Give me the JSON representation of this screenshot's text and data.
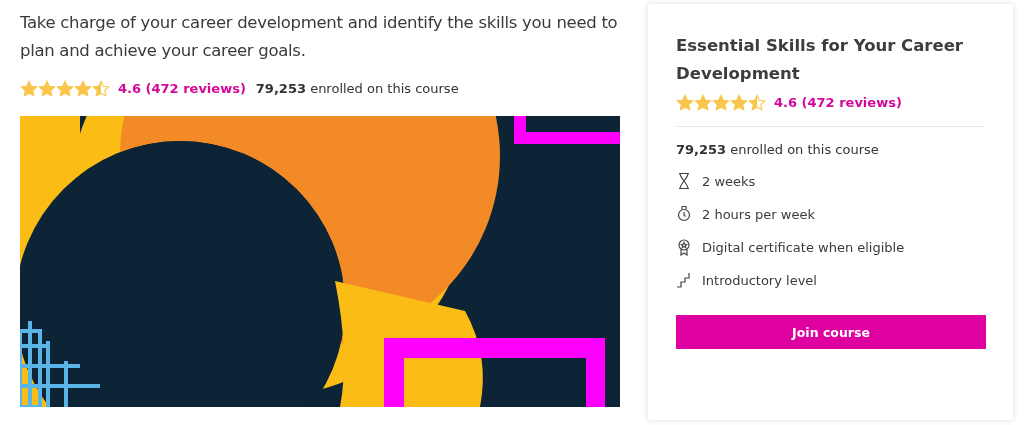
{
  "description": "Take charge of your career development and identify the skills you need to plan and achieve your career goals.",
  "rating": {
    "stars": 4.5,
    "text": "4.6 (472 reviews)"
  },
  "enrolled": "**79,253** enrolled on this course",
  "card": {
    "title": "Essential Skills for Your Career Development",
    "rating": {
      "stars": 4.5,
      "text": "4.6 (472 reviews)"
    },
    "enrolled": "**79,253** enrolled on this course",
    "features": [
      {
        "kind": "duration",
        "text": "2 weeks"
      },
      {
        "kind": "effort",
        "text": "2 hours per week"
      },
      {
        "kind": "certificate",
        "text": "Digital certificate when eligible"
      },
      {
        "kind": "level",
        "text": "Introductory level"
      }
    ],
    "button": "Join course"
  }
}
